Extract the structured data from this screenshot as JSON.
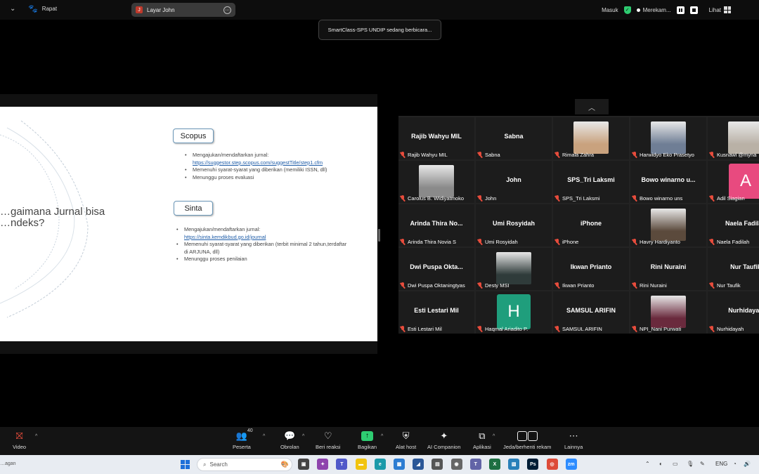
{
  "topbar": {
    "meeting_label": "Rapat",
    "screen_share_label": "Layar John",
    "screen_share_initial": "J",
    "signin_label": "Masuk",
    "recording_label": "Merekam...",
    "view_label": "Lihat"
  },
  "banner": {
    "speaking_text": "SmartClass-SPS UNDIP sedang berbicara..."
  },
  "slide": {
    "title": "…gaimana Jurnal bisa\n…ndeks?",
    "section1": {
      "heading": "Scopus",
      "bullets": [
        {
          "text": "Mengajukan/mendaftarkan jurnal:",
          "link": "https://suggestor.step.scopus.com/suggestTitle/step1.cfm"
        },
        {
          "text": "Memenuhi syarat-syarat yang diberikan (memiliki ISSN, dll)"
        },
        {
          "text": "Menunggu proses evaluasi"
        }
      ]
    },
    "section2": {
      "heading": "Sinta",
      "bullets": [
        {
          "text": "Mengajukan/mendaftarkan jurnal:",
          "link": "https://sinta.kemdikbud.go.id/journal"
        },
        {
          "text": "Memenuhi syarat-syarat yang diberikan (terbit minimal 2 tahun,terdaftar di ARJUNA, dll)"
        },
        {
          "text": "Menunggu proses penilaian"
        }
      ]
    }
  },
  "gallery": {
    "participants": [
      {
        "big": "Rajib Wahyu MIL",
        "label": "Rajib Wahyu MIL"
      },
      {
        "big": "Sabna",
        "label": "Sabna"
      },
      {
        "label": "Rimala Zahra",
        "photo": "#c9a27e"
      },
      {
        "label": "Harwidyo Eko Prasetyo",
        "photo": "#6f7e95"
      },
      {
        "label": "Kusnawi @myna",
        "photo": "#b9b1a6"
      },
      {
        "label": "Carolus B. Widiyatmoko",
        "photo": "#8a8a8a"
      },
      {
        "big": "John",
        "label": "John"
      },
      {
        "big": "SPS_Tri Laksmi",
        "label": "SPS_Tri Laksmi"
      },
      {
        "big": "Bowo winarno u...",
        "label": "Bowo winarno uns"
      },
      {
        "label": "Adil Siagian",
        "letter": "A",
        "letter_color": "#e84a7f"
      },
      {
        "big": "Arinda Thira No...",
        "label": "Arinda Thira Novia S"
      },
      {
        "big": "Umi Rosyidah",
        "label": "Umi Rosyidah"
      },
      {
        "big": "iPhone",
        "label": "iPhone"
      },
      {
        "label": "Havry Hardiyanto",
        "photo": "#5b4a3c"
      },
      {
        "big": "Naela Fadilah",
        "label": "Naela Fadilah"
      },
      {
        "big": "Dwi Puspa Okta...",
        "label": "Dwi Puspa Oktaningtyas"
      },
      {
        "label": "Desty MSI",
        "photo": "#2f3b3a"
      },
      {
        "big": "Ikwan Prianto",
        "label": "Ikwan Prianto"
      },
      {
        "big": "Rini Nuraini",
        "label": "Rini Nuraini"
      },
      {
        "big": "Nur Taufik",
        "label": "Nur Taufik"
      },
      {
        "big": "Esti Lestari Mil",
        "label": "Esti Lestari Mil"
      },
      {
        "label": "Haqmal Ariadito P.",
        "letter": "H",
        "letter_color": "#1f9e7c"
      },
      {
        "big": "SAMSUL ARIFIN",
        "label": "SAMSUL ARIFIN"
      },
      {
        "label": "NPI_Nani Purwati",
        "photo": "#6a2a3d"
      },
      {
        "big": "Nurhidayah",
        "label": "Nurhidayah"
      }
    ]
  },
  "toolbar": {
    "video": "Video",
    "participants": "Peserta",
    "participants_count": "40",
    "chat": "Obrolan",
    "reactions": "Beri reaksi",
    "share": "Bagikan",
    "host_tools": "Alat host",
    "ai_companion": "AI Companion",
    "apps": "Aplikasi",
    "pause_stop_record": "Jeda/berhenti rekam",
    "more": "Lainnya"
  },
  "taskbar": {
    "left_text": "…agan",
    "search_placeholder": "Search",
    "language": "ENG",
    "apps": [
      {
        "name": "task-view",
        "color": "#444",
        "glyph": "▣"
      },
      {
        "name": "copilot",
        "color": "#8e44ad",
        "glyph": "✦"
      },
      {
        "name": "teams",
        "color": "#5059c9",
        "glyph": "T"
      },
      {
        "name": "file-explorer",
        "color": "#f1c40f",
        "glyph": "▬"
      },
      {
        "name": "edge",
        "color": "#1b9aaa",
        "glyph": "e"
      },
      {
        "name": "store",
        "color": "#2d7dd2",
        "glyph": "▦"
      },
      {
        "name": "vs",
        "color": "#2b5797",
        "glyph": "◢"
      },
      {
        "name": "calculator",
        "color": "#555",
        "glyph": "▤"
      },
      {
        "name": "camera",
        "color": "#666",
        "glyph": "◉"
      },
      {
        "name": "teams-2",
        "color": "#6264a7",
        "glyph": "T"
      },
      {
        "name": "excel",
        "color": "#1d6f42",
        "glyph": "X"
      },
      {
        "name": "photos",
        "color": "#2980b9",
        "glyph": "▧"
      },
      {
        "name": "photoshop",
        "color": "#001e36",
        "glyph": "Ps"
      },
      {
        "name": "chrome",
        "color": "#dd4b39",
        "glyph": "◎"
      },
      {
        "name": "zoom",
        "color": "#2d8cff",
        "glyph": "zm"
      }
    ]
  }
}
